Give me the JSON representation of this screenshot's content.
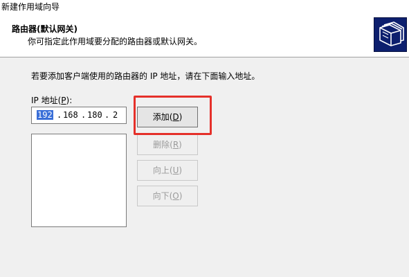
{
  "window": {
    "title": "新建作用域向导"
  },
  "header": {
    "title": "路由器(默认网关)",
    "subtitle": "你可指定此作用域要分配的路由器或默认网关。"
  },
  "instruction": "若要添加客户端使用的路由器的 IP 地址，请在下面输入地址。",
  "ip": {
    "label_prefix": "IP 地址(",
    "label_key": "P",
    "label_suffix": "):",
    "octets": [
      "192",
      "168",
      "180",
      "2"
    ],
    "dots": [
      ".",
      ".",
      "."
    ]
  },
  "buttons": {
    "add": {
      "prefix": "添加(",
      "key": "D",
      "suffix": ")"
    },
    "remove": {
      "prefix": "删除(",
      "key": "R",
      "suffix": ")"
    },
    "up": {
      "prefix": "向上(",
      "key": "U",
      "suffix": ")"
    },
    "down": {
      "prefix": "向下(",
      "key": "O",
      "suffix": ")"
    }
  },
  "colors": {
    "highlight": "#e5302a",
    "selection": "#3a6fd8",
    "logo_bg": "#0d1f6e"
  },
  "icons": {
    "header_logo": "wizard-folders-icon"
  }
}
